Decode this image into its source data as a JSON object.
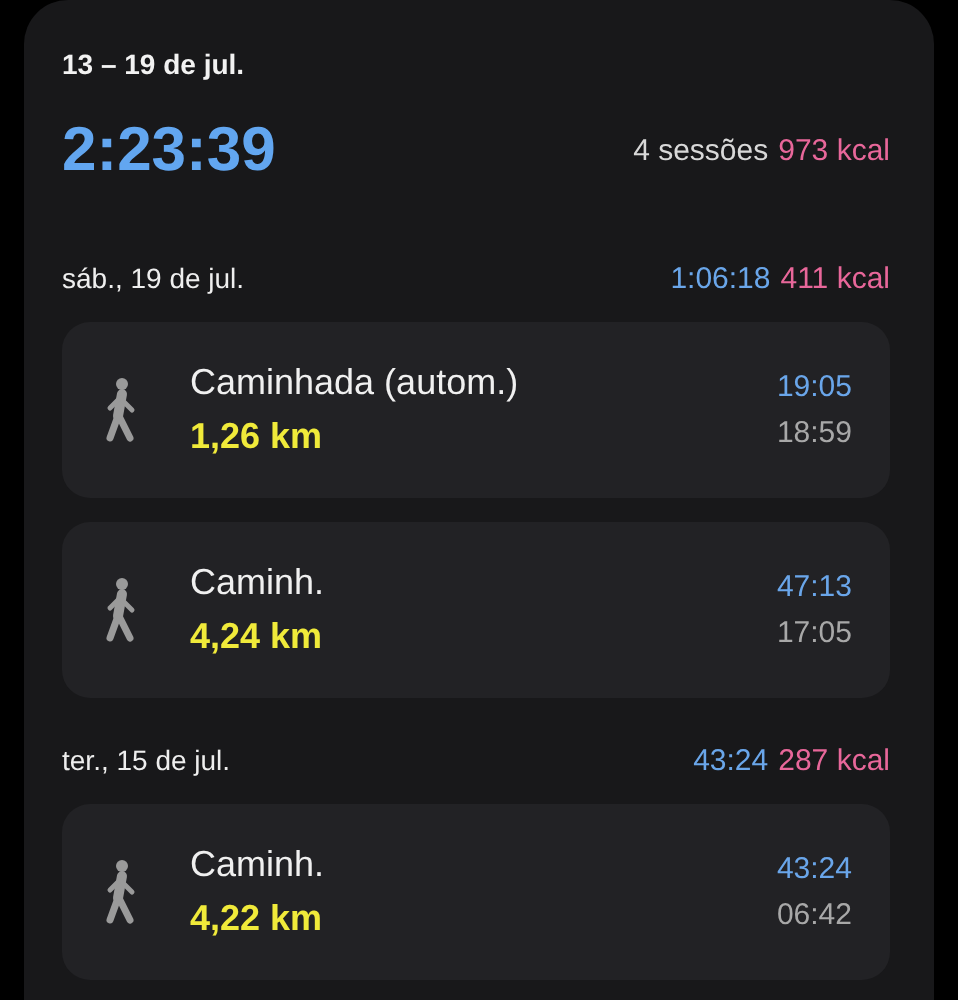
{
  "range": "13 – 19 de jul.",
  "total_time": "2:23:39",
  "sessions": "4 sessões",
  "total_kcal": "973 kcal",
  "days": [
    {
      "date": "sáb., 19 de jul.",
      "duration": "1:06:18",
      "kcal": "411 kcal",
      "workouts": [
        {
          "name": "Caminhada (autom.)",
          "distance": "1,26 km",
          "duration": "19:05",
          "start": "18:59"
        },
        {
          "name": "Caminh.",
          "distance": "4,24 km",
          "duration": "47:13",
          "start": "17:05"
        }
      ]
    },
    {
      "date": "ter., 15 de jul.",
      "duration": "43:24",
      "kcal": "287 kcal",
      "workouts": [
        {
          "name": "Caminh.",
          "distance": "4,22 km",
          "duration": "43:24",
          "start": "06:42"
        }
      ]
    }
  ]
}
